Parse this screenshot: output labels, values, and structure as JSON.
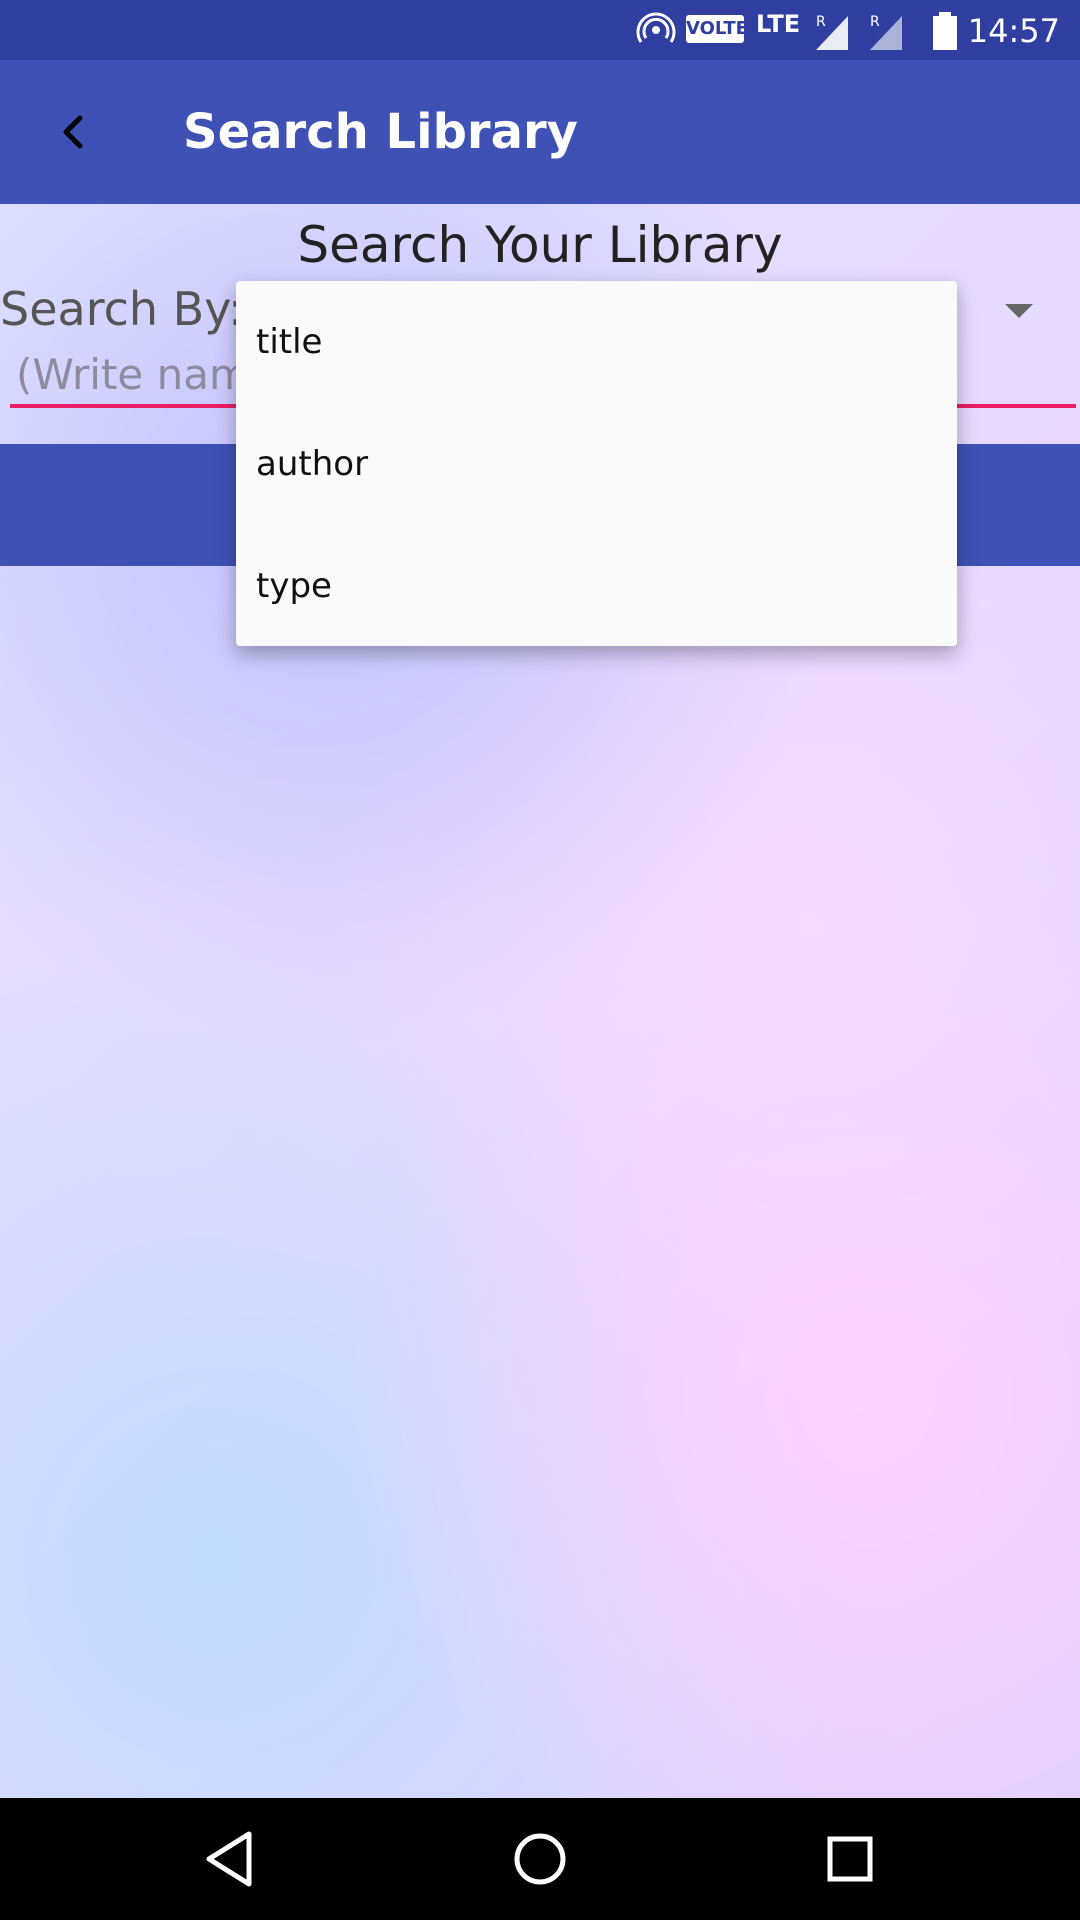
{
  "status_bar": {
    "time": "14:57",
    "volte": "VOLTE",
    "lte": "LTE",
    "icons": [
      "hotspot-icon",
      "signal-icon",
      "signal-icon",
      "battery-icon"
    ]
  },
  "app_bar": {
    "title": "Search Library",
    "back_icon": "arrow-back-icon",
    "color": "#3f51b5"
  },
  "content": {
    "heading": "Search Your Library",
    "search_by_label": "Search By:",
    "input_placeholder": "(Write name",
    "accent_color": "#e91e63"
  },
  "dropdown": {
    "options": [
      "title",
      "author",
      "type"
    ]
  },
  "nav_bar": {
    "buttons": [
      "back-nav-icon",
      "home-nav-icon",
      "recents-nav-icon"
    ]
  }
}
